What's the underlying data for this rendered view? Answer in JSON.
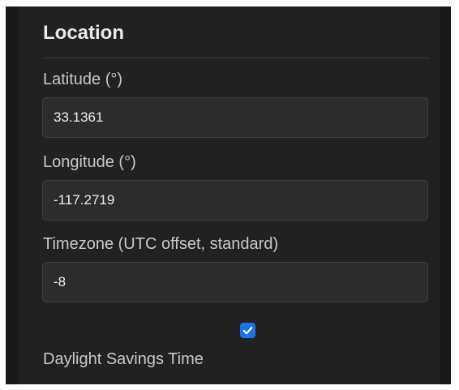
{
  "section": {
    "title": "Location"
  },
  "fields": [
    {
      "label": "Latitude (°)",
      "value": "33.1361"
    },
    {
      "label": "Longitude (°)",
      "value": "-117.2719"
    },
    {
      "label": "Timezone (UTC offset, standard)",
      "value": "-8"
    }
  ],
  "dst": {
    "label": "Daylight Savings Time",
    "checked": true,
    "icon": "checkmark-icon"
  },
  "colors": {
    "accent": "#1a73e8",
    "panel": "#212121",
    "input_bg": "#2c2c2c"
  }
}
